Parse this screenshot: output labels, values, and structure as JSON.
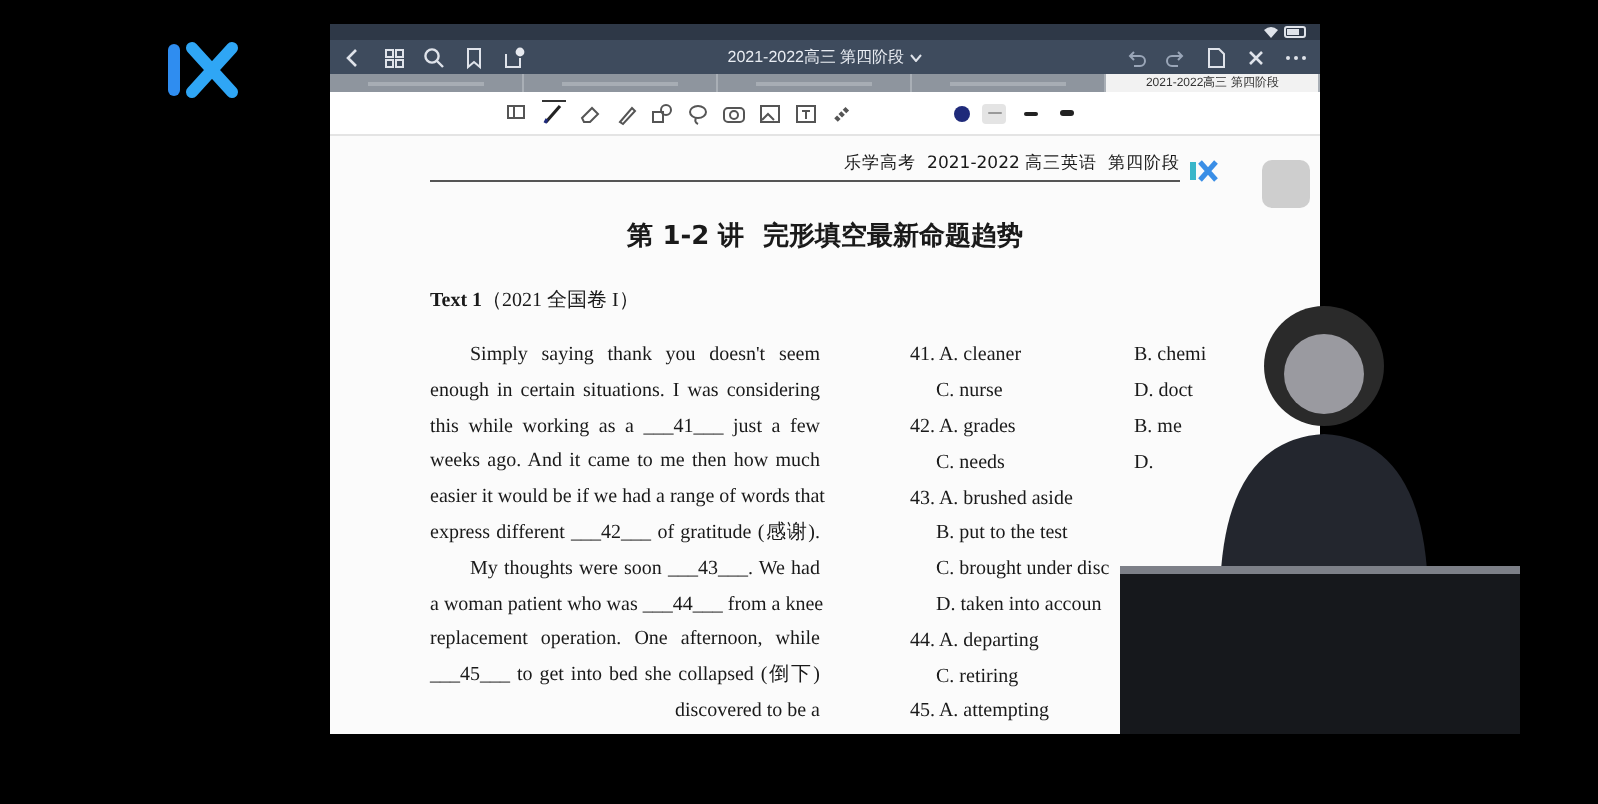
{
  "tablet": {
    "title": "2021-2022高三 第四阶段",
    "tabs": [
      {
        "selected": false
      },
      {
        "selected": false
      },
      {
        "selected": false
      },
      {
        "selected": false
      },
      {
        "label": "2021-2022高三 第四阶段",
        "selected": true
      }
    ],
    "tools": [
      {
        "kind": "panel",
        "selected": false
      },
      {
        "kind": "pen",
        "selected": true
      },
      {
        "kind": "eraser",
        "selected": false
      },
      {
        "kind": "highlighter",
        "selected": false
      },
      {
        "kind": "shapes",
        "selected": false
      },
      {
        "kind": "lasso",
        "selected": false
      },
      {
        "kind": "camera",
        "selected": false
      },
      {
        "kind": "image",
        "selected": false
      },
      {
        "kind": "textbox",
        "selected": false
      },
      {
        "kind": "link",
        "selected": false
      }
    ],
    "thickness": [
      {
        "selected": true
      },
      {
        "selected": false
      },
      {
        "selected": false
      }
    ]
  },
  "document": {
    "header": "乐学高考  2021-2022 高三英语  第四阶段",
    "title": "第 1-2 讲  完形填空最新命题趋势",
    "source": "**Text 1**（2021 全国卷 I）",
    "paragraphs": [
      {
        "lines": [
          "Simply saying thank you doesn't seem",
          "enough in certain situations. I was considering",
          "this while working as a ___41___ just a few",
          "weeks ago. And it came to me then how much",
          "easier it would be if we had a range of words that",
          "express different ___42___ of gratitude (感谢)."
        ]
      },
      {
        "lines": [
          "My thoughts were soon ___43___. We had",
          "a woman patient who was ___44___ from a knee",
          "replacement operation. One afternoon, while",
          "___45___ to get into bed she collapsed (倒下)",
          "discovered to be a"
        ]
      }
    ],
    "options": [
      {
        "kind": "first",
        "left": "41. A. cleaner",
        "right": "B. chemi"
      },
      {
        "kind": "cont",
        "left": "C. nurse",
        "right": "D. doct"
      },
      {
        "kind": "first",
        "left": "42. A. grades",
        "right": "B. me"
      },
      {
        "kind": "cont",
        "left": "C. needs",
        "right": "D."
      },
      {
        "kind": "first",
        "left": "43. A. brushed aside"
      },
      {
        "kind": "cont",
        "left": "B. put to the test"
      },
      {
        "kind": "cont",
        "left": "C. brought under disc"
      },
      {
        "kind": "cont",
        "left": "D. taken into accoun"
      },
      {
        "kind": "first",
        "left": "44. A. departing"
      },
      {
        "kind": "cont",
        "left": "C. retiring"
      },
      {
        "kind": "first",
        "left": "45. A. attempting"
      }
    ]
  }
}
